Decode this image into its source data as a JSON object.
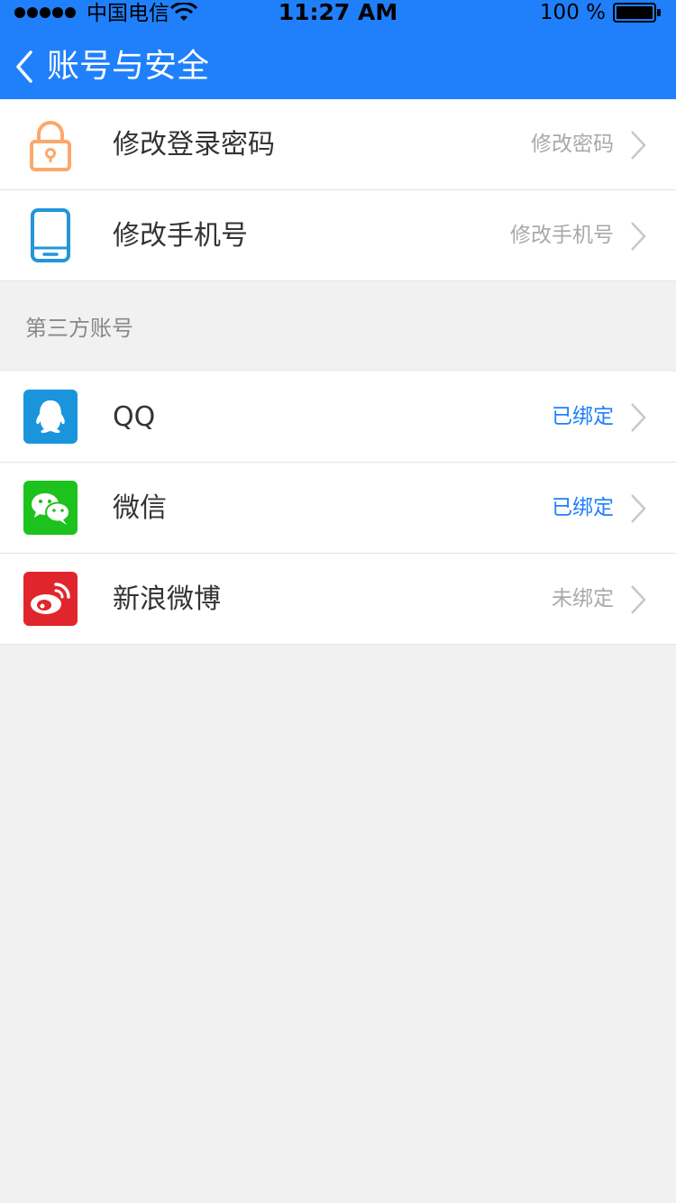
{
  "status_bar": {
    "carrier": "中国电信",
    "time": "11:27 AM",
    "battery": "100 %"
  },
  "header": {
    "title": "账号与安全",
    "back_icon": "chevron-left-icon"
  },
  "colors": {
    "brand": "#2080fb",
    "bound": "#2080fb",
    "unbound": "#a9a9a9",
    "qq": "#1a95dc",
    "wechat": "#1ec21d",
    "weibo": "#e0262c",
    "lock": "#fca86a",
    "phone": "#2296d8"
  },
  "security": {
    "items": [
      {
        "icon": "lock-icon",
        "label": "修改登录密码",
        "value": "修改密码"
      },
      {
        "icon": "phone-icon",
        "label": "修改手机号",
        "value": "修改手机号"
      }
    ]
  },
  "third_party": {
    "section_title": "第三方账号",
    "items": [
      {
        "icon": "qq-icon",
        "label": "QQ",
        "status": "已绑定"
      },
      {
        "icon": "wechat-icon",
        "label": "微信",
        "status": "已绑定"
      },
      {
        "icon": "weibo-icon",
        "label": "新浪微博",
        "status": "未绑定"
      }
    ]
  }
}
